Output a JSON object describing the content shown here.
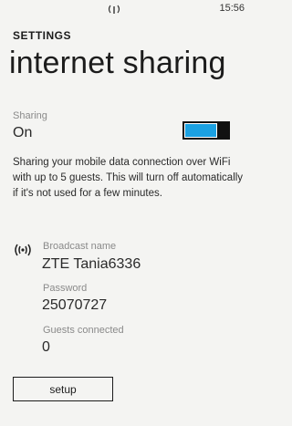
{
  "status_bar": {
    "time": "15:56",
    "signal_icon": "broadcast-icon"
  },
  "app_title": "SETTINGS",
  "page_title": "internet sharing",
  "sharing": {
    "label": "Sharing",
    "state": "On",
    "toggle_on": true,
    "accent_color": "#1ba1e2"
  },
  "description": "Sharing your mobile data connection over WiFi with up to 5 guests. This will turn off automatically if it's not used for a few minutes.",
  "broadcast": {
    "icon": "broadcast-icon",
    "label": "Broadcast name",
    "value": "ZTE Tania6336"
  },
  "password": {
    "label": "Password",
    "value": "25070727"
  },
  "guests": {
    "label": "Guests connected",
    "value": "0"
  },
  "setup_button": "setup"
}
